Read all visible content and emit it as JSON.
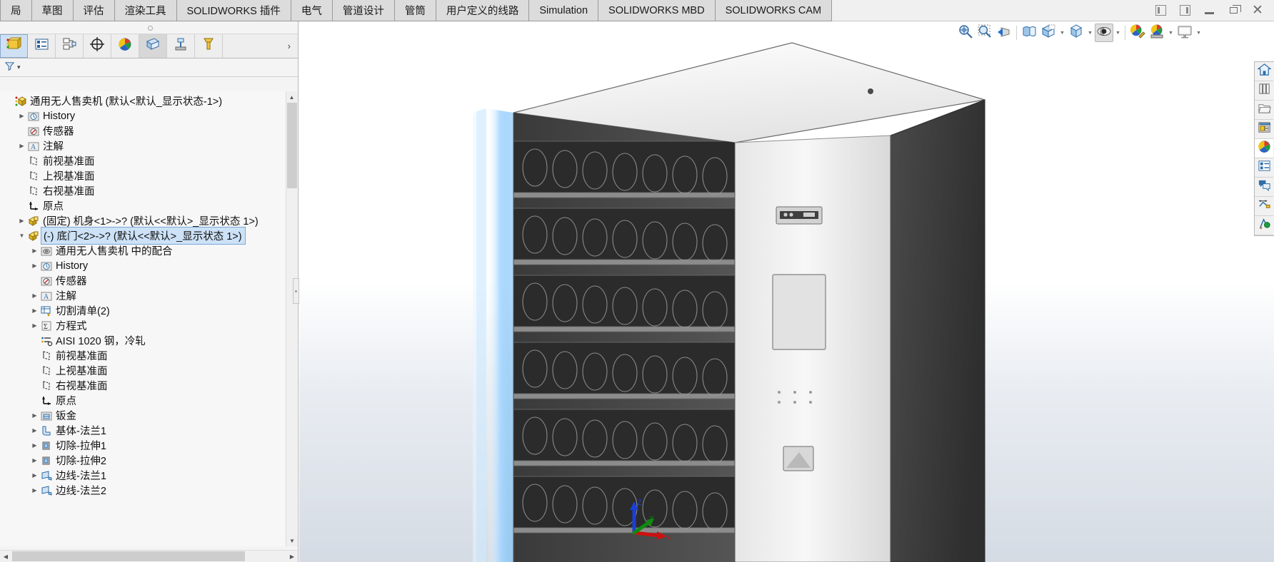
{
  "window": {
    "controls": [
      {
        "name": "restore-left-icon",
        "glyph": "left-box"
      },
      {
        "name": "restore-right-icon",
        "glyph": "right-box"
      },
      {
        "name": "minimize-icon",
        "glyph": "minimize"
      },
      {
        "name": "maximize-icon",
        "glyph": "maximize"
      },
      {
        "name": "close-icon",
        "glyph": "×"
      }
    ]
  },
  "ribbon": {
    "tabs": [
      {
        "label": "局",
        "name": "tab-layout-partial"
      },
      {
        "label": "草图",
        "name": "tab-sketch"
      },
      {
        "label": "评估",
        "name": "tab-evaluate"
      },
      {
        "label": "渲染工具",
        "name": "tab-render-tools"
      },
      {
        "label": "SOLIDWORKS 插件",
        "name": "tab-solidworks-addins"
      },
      {
        "label": "电气",
        "name": "tab-electrical"
      },
      {
        "label": "管道设计",
        "name": "tab-routing-piping"
      },
      {
        "label": "管筒",
        "name": "tab-tubing"
      },
      {
        "label": "用户定义的线路",
        "name": "tab-user-defined-route"
      },
      {
        "label": "Simulation",
        "name": "tab-simulation"
      },
      {
        "label": "SOLIDWORKS MBD",
        "name": "tab-solidworks-mbd"
      },
      {
        "label": "SOLIDWORKS CAM",
        "name": "tab-solidworks-cam"
      }
    ]
  },
  "manager_tabs": [
    {
      "name": "feature-manager-design-tree-tab",
      "icon": "feature-tree-icon",
      "selected": true
    },
    {
      "name": "property-manager-tab",
      "icon": "property-manager-icon",
      "selected": false
    },
    {
      "name": "configuration-manager-tab",
      "icon": "configuration-manager-icon",
      "selected": false
    },
    {
      "name": "dimxpert-manager-tab",
      "icon": "dimxpert-icon",
      "selected": false
    },
    {
      "name": "display-manager-tab",
      "icon": "display-manager-icon",
      "selected": false
    },
    {
      "name": "appearance-copy-tab",
      "icon": "appearance-copy-icon",
      "selected": false
    },
    {
      "name": "simulation-manager-tab",
      "icon": "simulation-icon",
      "selected": false
    },
    {
      "name": "cam-manager-tab",
      "icon": "cam-tool-icon",
      "selected": false
    }
  ],
  "manager_overflow_label": "›",
  "filter_bar": {
    "name": "tree-filter",
    "icon": "filter-icon",
    "caret": "▾"
  },
  "tree": [
    {
      "indent": 0,
      "twisty": "none",
      "icon": "assembly-icon",
      "label": "通用无人售卖机  (默认<默认_显示状态-1>)",
      "selected": false,
      "name": "tree-item-assembly-root"
    },
    {
      "indent": 1,
      "twisty": "collapsed",
      "icon": "history-icon",
      "label": "History",
      "selected": false,
      "name": "tree-item-history"
    },
    {
      "indent": 1,
      "twisty": "none",
      "icon": "sensor-icon",
      "label": "传感器",
      "selected": false,
      "name": "tree-item-sensors"
    },
    {
      "indent": 1,
      "twisty": "collapsed",
      "icon": "annotation-icon",
      "label": "注解",
      "selected": false,
      "name": "tree-item-annotations"
    },
    {
      "indent": 1,
      "twisty": "none",
      "icon": "plane-icon",
      "label": "前视基准面",
      "selected": false,
      "name": "tree-item-front-plane"
    },
    {
      "indent": 1,
      "twisty": "none",
      "icon": "plane-icon",
      "label": "上视基准面",
      "selected": false,
      "name": "tree-item-top-plane"
    },
    {
      "indent": 1,
      "twisty": "none",
      "icon": "plane-icon",
      "label": "右视基准面",
      "selected": false,
      "name": "tree-item-right-plane"
    },
    {
      "indent": 1,
      "twisty": "none",
      "icon": "origin-icon",
      "label": "原点",
      "selected": false,
      "name": "tree-item-origin"
    },
    {
      "indent": 1,
      "twisty": "collapsed",
      "icon": "component-icon",
      "label": "(固定) 机身<1>->? (默认<<默认>_显示状态 1>)",
      "selected": false,
      "name": "tree-item-component-body"
    },
    {
      "indent": 1,
      "twisty": "expanded",
      "icon": "component-icon",
      "label": "(-) 底门<2>->? (默认<<默认>_显示状态 1>)",
      "selected": true,
      "name": "tree-item-component-bottom-door"
    },
    {
      "indent": 2,
      "twisty": "collapsed",
      "icon": "mates-icon",
      "label": "通用无人售卖机 中的配合",
      "selected": false,
      "name": "tree-item-mates-in-assembly"
    },
    {
      "indent": 2,
      "twisty": "collapsed",
      "icon": "history-icon",
      "label": "History",
      "selected": false,
      "name": "tree-item-child-history"
    },
    {
      "indent": 2,
      "twisty": "none",
      "icon": "sensor-icon",
      "label": "传感器",
      "selected": false,
      "name": "tree-item-child-sensors"
    },
    {
      "indent": 2,
      "twisty": "collapsed",
      "icon": "annotation-icon",
      "label": "注解",
      "selected": false,
      "name": "tree-item-child-annotations"
    },
    {
      "indent": 2,
      "twisty": "collapsed",
      "icon": "cutlist-icon",
      "label": "切割清单(2)",
      "selected": false,
      "name": "tree-item-cut-list"
    },
    {
      "indent": 2,
      "twisty": "collapsed",
      "icon": "equations-icon",
      "label": "方程式",
      "selected": false,
      "name": "tree-item-equations"
    },
    {
      "indent": 2,
      "twisty": "none",
      "icon": "material-icon",
      "label": "AISI 1020 钢，冷轧",
      "selected": false,
      "name": "tree-item-material"
    },
    {
      "indent": 2,
      "twisty": "none",
      "icon": "plane-icon",
      "label": "前视基准面",
      "selected": false,
      "name": "tree-item-child-front-plane"
    },
    {
      "indent": 2,
      "twisty": "none",
      "icon": "plane-icon",
      "label": "上视基准面",
      "selected": false,
      "name": "tree-item-child-top-plane"
    },
    {
      "indent": 2,
      "twisty": "none",
      "icon": "plane-icon",
      "label": "右视基准面",
      "selected": false,
      "name": "tree-item-child-right-plane"
    },
    {
      "indent": 2,
      "twisty": "none",
      "icon": "origin-icon",
      "label": "原点",
      "selected": false,
      "name": "tree-item-child-origin"
    },
    {
      "indent": 2,
      "twisty": "collapsed",
      "icon": "sheetmetal-icon",
      "label": "钣金",
      "selected": false,
      "name": "tree-item-sheet-metal"
    },
    {
      "indent": 2,
      "twisty": "collapsed",
      "icon": "baseflange-icon",
      "label": "基体-法兰1",
      "selected": false,
      "name": "tree-item-base-flange-1"
    },
    {
      "indent": 2,
      "twisty": "collapsed",
      "icon": "extrudecut-icon",
      "label": "切除-拉伸1",
      "selected": false,
      "name": "tree-item-extrude-cut-1"
    },
    {
      "indent": 2,
      "twisty": "collapsed",
      "icon": "extrudecut-icon",
      "label": "切除-拉伸2",
      "selected": false,
      "name": "tree-item-extrude-cut-2"
    },
    {
      "indent": 2,
      "twisty": "collapsed",
      "icon": "edgeflange-icon",
      "label": "边线-法兰1",
      "selected": false,
      "name": "tree-item-edge-flange-1"
    },
    {
      "indent": 2,
      "twisty": "collapsed",
      "icon": "edgeflange-icon",
      "label": "边线-法兰2",
      "selected": false,
      "name": "tree-item-edge-flange-2"
    }
  ],
  "view_toolbar": [
    {
      "name": "zoom-to-fit-button",
      "icon": "zoom-to-fit-icon",
      "caret": false,
      "active": false
    },
    {
      "name": "zoom-to-area-button",
      "icon": "zoom-to-area-icon",
      "caret": false,
      "active": false
    },
    {
      "name": "previous-view-button",
      "icon": "previous-view-icon",
      "caret": false,
      "active": false
    },
    {
      "name": "section-view-button",
      "icon": "section-view-icon",
      "caret": false,
      "active": false
    },
    {
      "name": "view-orientation-button",
      "icon": "view-orientation-icon",
      "caret": true,
      "active": false
    },
    {
      "name": "display-style-button",
      "icon": "display-style-icon",
      "caret": true,
      "active": false
    },
    {
      "name": "hide-show-items-button",
      "icon": "eye-icon",
      "caret": true,
      "active": true
    },
    {
      "name": "edit-appearance-button",
      "icon": "appearance-pencil-icon",
      "caret": false,
      "active": false
    },
    {
      "name": "apply-scene-button",
      "icon": "scene-icon",
      "caret": true,
      "active": false
    },
    {
      "name": "view-settings-button",
      "icon": "monitor-icon",
      "caret": true,
      "active": false
    }
  ],
  "task_pane": [
    {
      "name": "task-pane-resources",
      "icon": "home-icon",
      "active": false
    },
    {
      "name": "task-pane-design-library",
      "icon": "design-library-icon",
      "active": false
    },
    {
      "name": "task-pane-file-explorer",
      "icon": "folder-icon",
      "active": false
    },
    {
      "name": "task-pane-view-palette",
      "icon": "view-palette-icon",
      "active": false
    },
    {
      "name": "task-pane-appearances-scenes",
      "icon": "appearances-sphere-icon",
      "active": true
    },
    {
      "name": "task-pane-custom-properties",
      "icon": "custom-properties-icon",
      "active": false
    },
    {
      "name": "task-pane-forum",
      "icon": "chat-bubbles-icon",
      "active": false
    },
    {
      "name": "task-pane-dimxpert",
      "icon": "dimxpert-pane-icon",
      "active": false
    },
    {
      "name": "task-pane-mbd",
      "icon": "mbd-pane-icon",
      "active": false
    }
  ],
  "triad": {
    "z_label": "Z",
    "y_label": "y",
    "x_label": "x"
  },
  "colors": {
    "selection_blue": "#cde2f7",
    "selection_border": "#7ba7d7",
    "tab_bg": "#dcdcdc",
    "panel_bg": "#f4f4f4",
    "viewport_top": "#ffffff",
    "viewport_bottom": "#d5dbe4",
    "machine_dark": "#3c3c3c",
    "machine_light": "#f0f0f0",
    "glow_blue": "#7fc4ff"
  }
}
